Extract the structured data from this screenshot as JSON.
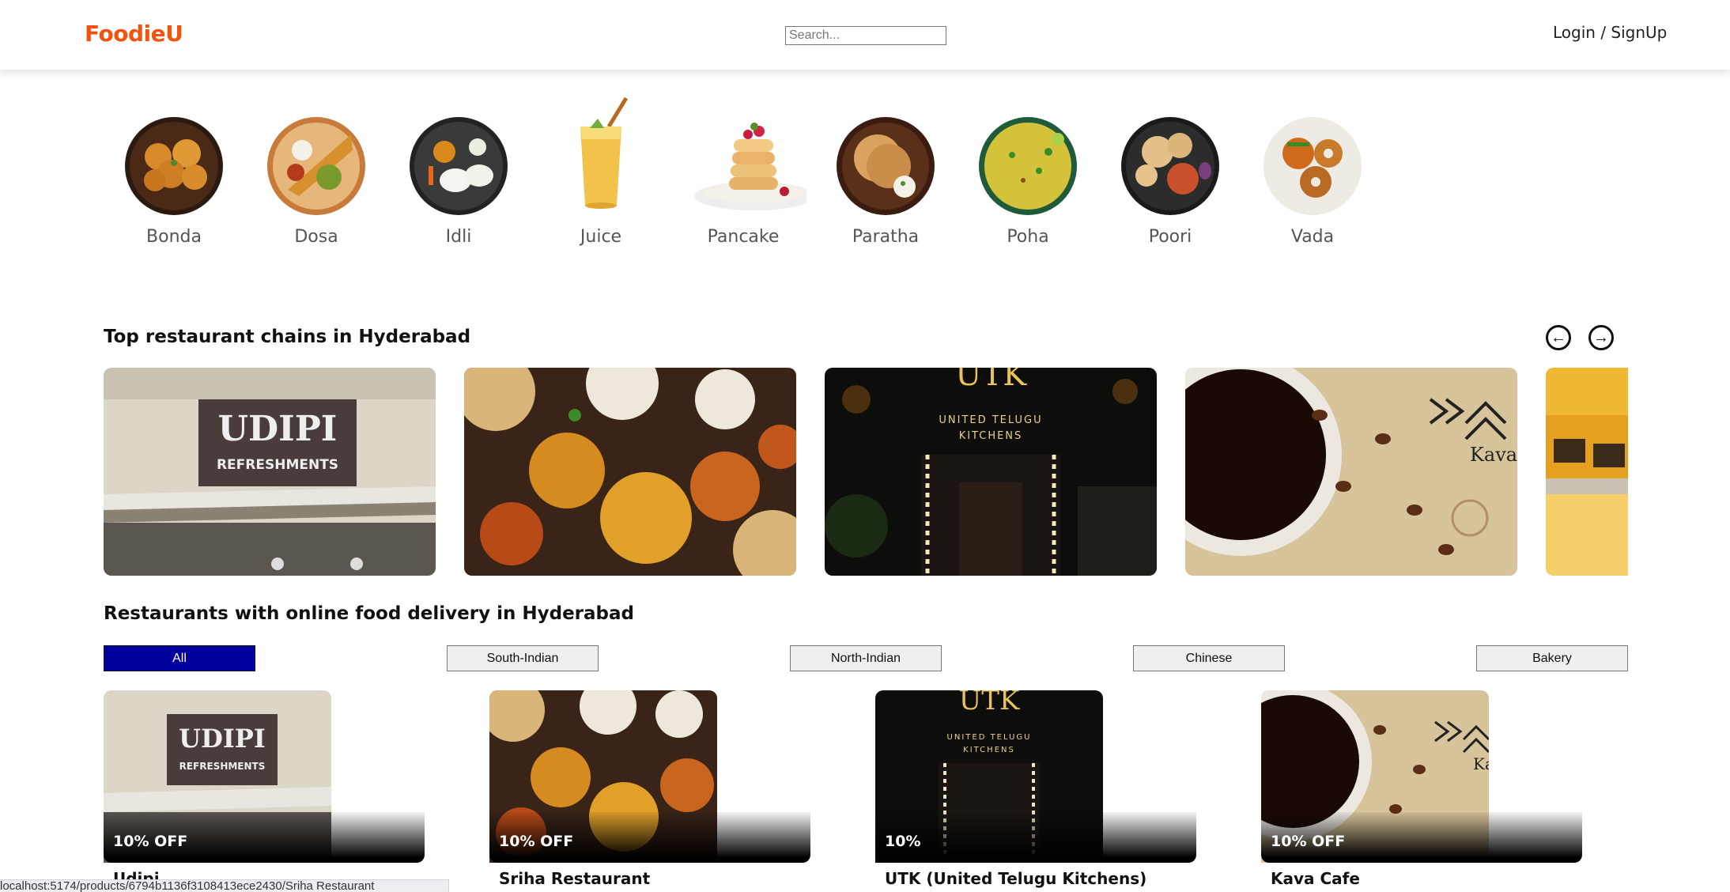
{
  "header": {
    "logo": "FoodieU",
    "search_placeholder": "Search...",
    "login_label": "Login / SignUp"
  },
  "categories": [
    {
      "label": "Bonda"
    },
    {
      "label": "Dosa"
    },
    {
      "label": "Idli"
    },
    {
      "label": "Juice"
    },
    {
      "label": "Pancake"
    },
    {
      "label": "Paratha"
    },
    {
      "label": "Poha"
    },
    {
      "label": "Poori"
    },
    {
      "label": "Vada"
    }
  ],
  "chains": {
    "title": "Top restaurant chains in Hyderabad",
    "prev_icon": "arrow-left-circle-icon",
    "next_icon": "arrow-right-circle-icon",
    "cards": [
      {
        "sign_line1": "UDIPI",
        "sign_line2": "REFRESHMENTS"
      },
      {
        "image": "indian-thali-spread"
      },
      {
        "sign_line1": "UTK",
        "sign_line2": "UNITED TELUGU",
        "sign_line3": "KITCHENS"
      },
      {
        "sign_line1": "Kava"
      },
      {
        "image": "bakery-counter"
      }
    ]
  },
  "delivery": {
    "title": "Restaurants with online food delivery in Hyderabad",
    "filters": [
      "All",
      "South-Indian",
      "North-Indian",
      "Chinese",
      "Bakery"
    ],
    "active_filter": "All",
    "restaurants": [
      {
        "name": "Udipi",
        "offer": "10% OFF",
        "sign_line1": "UDIPI",
        "sign_line2": "REFRESHMENTS"
      },
      {
        "name": "Sriha Restaurant",
        "offer": "10% OFF"
      },
      {
        "name": "UTK (United Telugu Kitchens)",
        "offer": "10%",
        "sign_line1": "UTK",
        "sign_line2": "UNITED TELUGU",
        "sign_line3": "KITCHENS"
      },
      {
        "name": "Kava Cafe",
        "offer": "10% OFF",
        "sign_line1": "Ka"
      }
    ]
  },
  "status_bar": {
    "url": "localhost:5174/products/6794b1136f3108413ece2430/Sriha Restaurant"
  },
  "colors": {
    "brand": "#f2540f",
    "active_filter": "#00009c"
  }
}
